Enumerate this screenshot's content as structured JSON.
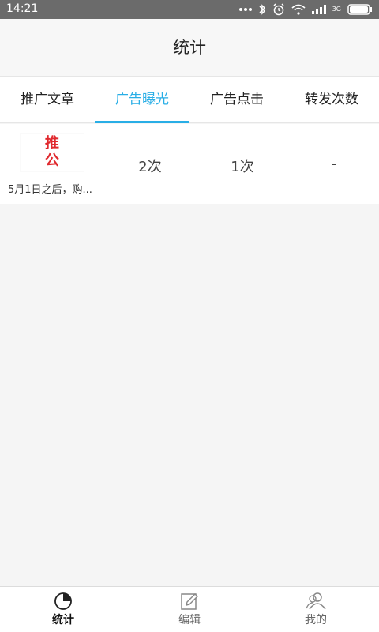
{
  "status_bar": {
    "time": "14:21",
    "network_label": "3G"
  },
  "header": {
    "title": "统计"
  },
  "tabs": [
    {
      "label": "推广文章",
      "active": false
    },
    {
      "label": "广告曝光",
      "active": true
    },
    {
      "label": "广告点击",
      "active": false
    },
    {
      "label": "转发次数",
      "active": false
    }
  ],
  "rows": [
    {
      "thumb_text": [
        "推",
        "公"
      ],
      "caption": "5月1日之后，购...",
      "exposure": "2次",
      "clicks": "1次",
      "shares": "-"
    }
  ],
  "bottom_nav": [
    {
      "label": "统计",
      "icon": "pie-chart-icon",
      "active": true
    },
    {
      "label": "编辑",
      "icon": "edit-icon",
      "active": false
    },
    {
      "label": "我的",
      "icon": "user-icon",
      "active": false
    }
  ],
  "colors": {
    "accent": "#29aee6",
    "thumb_text": "#e0292e"
  }
}
